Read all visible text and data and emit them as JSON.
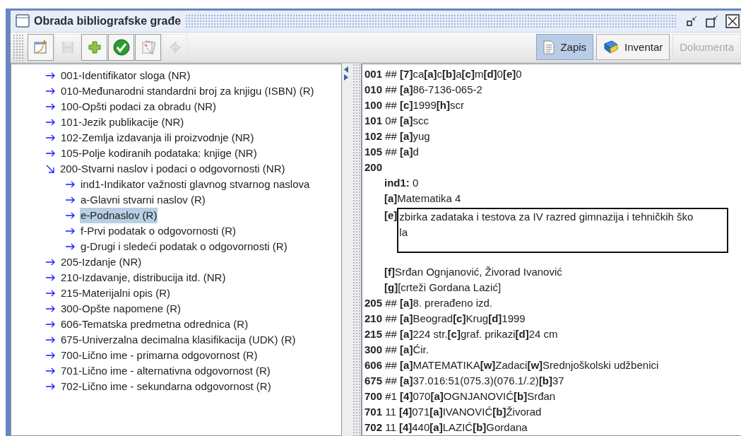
{
  "window": {
    "title": "Obrada bibliografske građe"
  },
  "toolbar": {
    "buttons": [
      {
        "kind": "new",
        "disabled": false
      },
      {
        "kind": "save",
        "disabled": true
      },
      {
        "kind": "add",
        "disabled": false
      },
      {
        "kind": "check",
        "disabled": false
      },
      {
        "kind": "cards",
        "disabled": false
      },
      {
        "kind": "refresh",
        "disabled": true
      }
    ],
    "views": [
      {
        "kind": "record",
        "label": "Zapis",
        "selected": true,
        "disabled": false
      },
      {
        "kind": "book",
        "label": "Inventar",
        "selected": false,
        "disabled": false
      },
      {
        "kind": "text",
        "label": "Dokumenta",
        "selected": false,
        "disabled": true
      }
    ]
  },
  "tree": [
    {
      "label": "001-Identifikator sloga (NR)",
      "selected": false
    },
    {
      "label": "010-Međunarodni standardni broj za knjigu (ISBN) (R)",
      "selected": false
    },
    {
      "label": "100-Opšti podaci za obradu (NR)",
      "selected": false
    },
    {
      "label": "101-Jezik publikacije (NR)",
      "selected": false
    },
    {
      "label": "102-Zemlja izdavanja ili proizvodnje (NR)",
      "selected": false
    },
    {
      "label": "105-Polje kodiranih podataka: knjige (NR)",
      "selected": false
    },
    {
      "label": "200-Stvarni naslov i podaci o odgovornosti (NR)",
      "selected": false,
      "expanded": true,
      "children": [
        {
          "label": "ind1-Indikator važnosti glavnog stvarnog naslova",
          "selected": false
        },
        {
          "label": "a-Glavni stvarni naslov (R)",
          "selected": false
        },
        {
          "label": "e-Podnaslov (R)",
          "selected": true
        },
        {
          "label": "f-Prvi podatak o odgovornosti (R)",
          "selected": false
        },
        {
          "label": "g-Drugi i sledeći podatak o odgovornosti (R)",
          "selected": false
        }
      ]
    },
    {
      "label": "205-Izdanje (NR)",
      "selected": false
    },
    {
      "label": "210-Izdavanje, distribucija itd. (NR)",
      "selected": false
    },
    {
      "label": "215-Materijalni opis (R)",
      "selected": false
    },
    {
      "label": "300-Opšte napomene (R)",
      "selected": false
    },
    {
      "label": "606-Tematska predmetna odrednica (R)",
      "selected": false
    },
    {
      "label": "675-Univerzalna decimalna klasifikacija (UDK) (R)",
      "selected": false
    },
    {
      "label": "700-Lično ime - primarna odgovornost (R)",
      "selected": false
    },
    {
      "label": "701-Lično ime - alternativna odgovornost (R)",
      "selected": false
    },
    {
      "label": "702-Lično ime - sekundarna odgovornost (R)",
      "selected": false
    }
  ],
  "record": [
    {
      "kind": "field",
      "text": "**001** ## **[7]**ca**[a]**c**[b]**a**[c]**m**[d]**0**[e]**0"
    },
    {
      "kind": "field",
      "text": "**010** ## **[a]**86-7136-065-2"
    },
    {
      "kind": "field",
      "text": "**100** ## **[c]**1999**[h]**scr"
    },
    {
      "kind": "field",
      "text": "**101** 0# **[a]**scc"
    },
    {
      "kind": "field",
      "text": "**102** ## **[a]**yug"
    },
    {
      "kind": "field",
      "text": "**105** ## **[a]**d"
    },
    {
      "kind": "field",
      "text": "**200**"
    },
    {
      "kind": "subfield",
      "text": "**ind1:** 0"
    },
    {
      "kind": "subfield",
      "text": "**[a]**Matematika 4"
    },
    {
      "kind": "editor",
      "label": "[e]",
      "lines": [
        "zbirka zadataka i testova za IV razred gimnazija i tehničkih ško",
        "la"
      ]
    },
    {
      "kind": "subfield",
      "text": "**[f]**Srđan Ognjanović, Živorad Ivanović"
    },
    {
      "kind": "subfield",
      "text": "**[g]**[crteži Gordana Lazić]"
    },
    {
      "kind": "field",
      "text": "**205** ## **[a]**8. prerađeno izd."
    },
    {
      "kind": "field",
      "text": "**210** ## **[a]**Beograd**[c]**Krug**[d]**1999"
    },
    {
      "kind": "field",
      "text": "**215** ## **[a]**224 str.**[c]**graf. prikazi**[d]**24 cm"
    },
    {
      "kind": "field",
      "text": "**300** ## **[a]**Ćir."
    },
    {
      "kind": "field",
      "text": "**606** ## **[a]**MATEMATIKA**[w]**Zadaci**[w]**Srednjoškolski udžbenici"
    },
    {
      "kind": "field",
      "text": "**675** ## **[a]**37.016:51(075.3)(076.1/.2)**[b]**37"
    },
    {
      "kind": "field",
      "text": "**700** #1 **[4]**070**[a]**OGNJANOVIĆ**[b]**Srđan"
    },
    {
      "kind": "field",
      "text": "**701** 11 **[4]**071**[a]**IVANOVIĆ**[b]**Živorad"
    },
    {
      "kind": "field",
      "text": "**702** 11 **[4]**440**[a]**LAZIĆ**[b]**Gordana"
    }
  ]
}
